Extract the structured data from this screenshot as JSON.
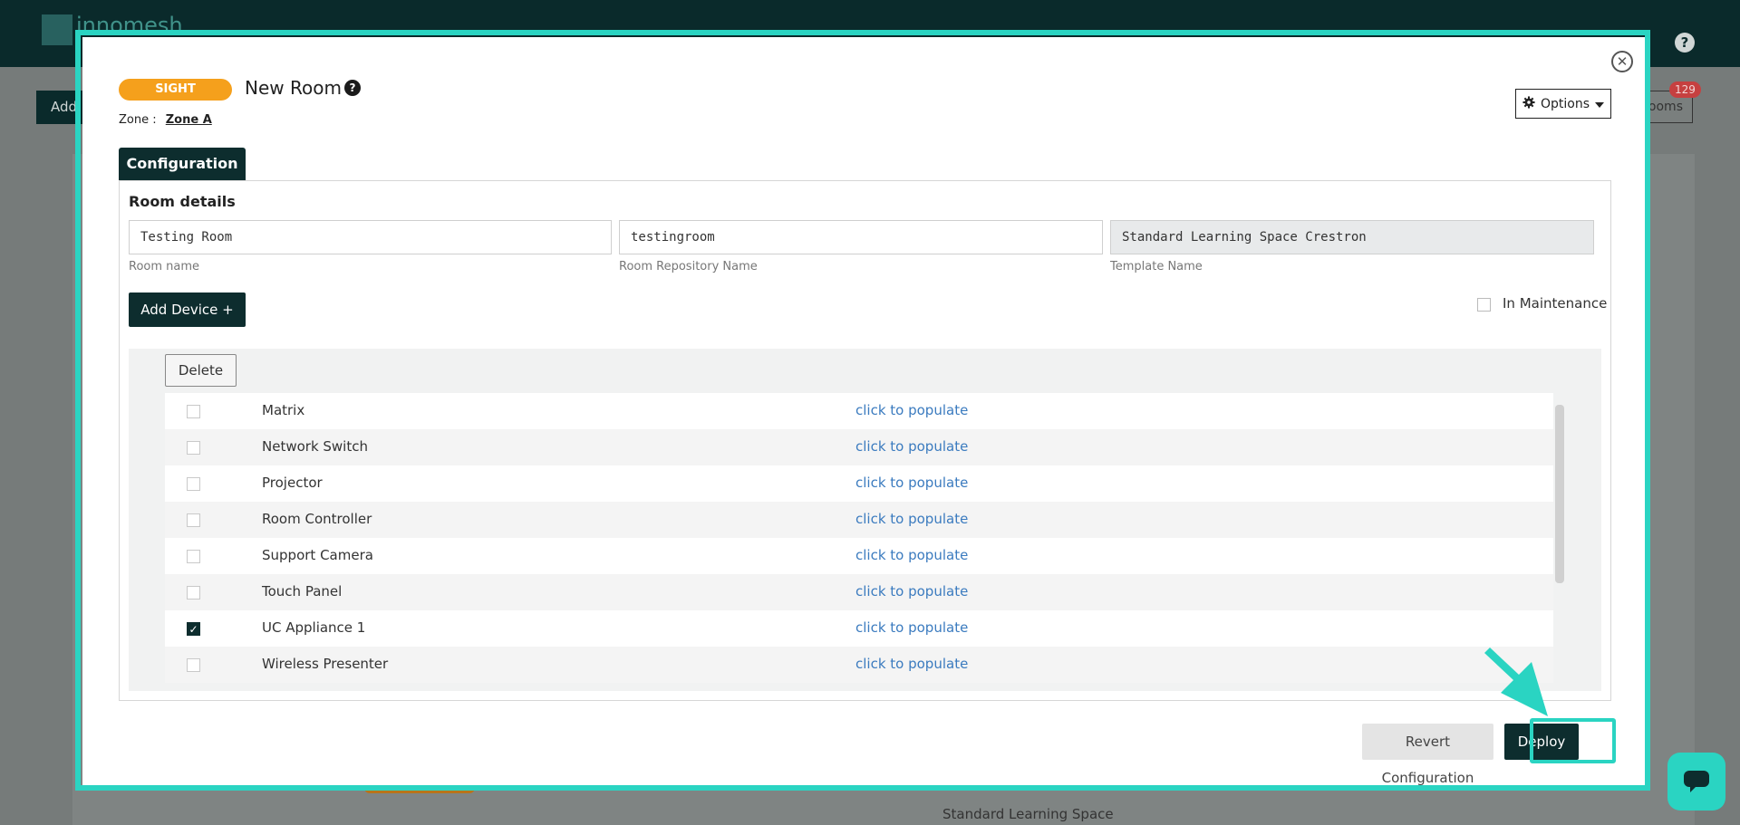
{
  "background": {
    "logo_text": "innomesh",
    "add_button": "Add",
    "rooms_button": "Rooms",
    "rooms_count": "129",
    "help": "?",
    "rows": [
      {
        "text": "Standard Learning Space"
      }
    ]
  },
  "modal": {
    "sight_badge": "SIGHT",
    "title": "New Room",
    "help_icon": "?",
    "zone_label": "Zone :",
    "zone_value": "Zone A",
    "options_label": "Options",
    "tab_configuration": "Configuration",
    "room_details_title": "Room details",
    "fields": {
      "room_name": {
        "value": "Testing Room",
        "label": "Room name"
      },
      "repo_name": {
        "value": "testingroom",
        "label": "Room Repository Name"
      },
      "template_name": {
        "value": "Standard Learning Space Crestron",
        "label": "Template Name"
      }
    },
    "add_device_label": "Add Device +",
    "in_maintenance_label": "In Maintenance",
    "delete_label": "Delete",
    "devices": [
      {
        "name": "Matrix",
        "action": "click to populate",
        "checked": false
      },
      {
        "name": "Network Switch",
        "action": "click to populate",
        "checked": false
      },
      {
        "name": "Projector",
        "action": "click to populate",
        "checked": false
      },
      {
        "name": "Room Controller",
        "action": "click to populate",
        "checked": false
      },
      {
        "name": "Support Camera",
        "action": "click to populate",
        "checked": false
      },
      {
        "name": "Touch Panel",
        "action": "click to populate",
        "checked": false
      },
      {
        "name": "UC Appliance 1",
        "action": "click to populate",
        "checked": true
      },
      {
        "name": "Wireless Presenter",
        "action": "click to populate",
        "checked": false
      }
    ],
    "revert_label": "Revert Configuration",
    "deploy_label": "Deploy"
  },
  "colors": {
    "accent": "#2ad4c2",
    "primary_dark": "#0d2d2e",
    "sight_orange": "#f5a01c",
    "link_blue": "#3b7bbf"
  }
}
